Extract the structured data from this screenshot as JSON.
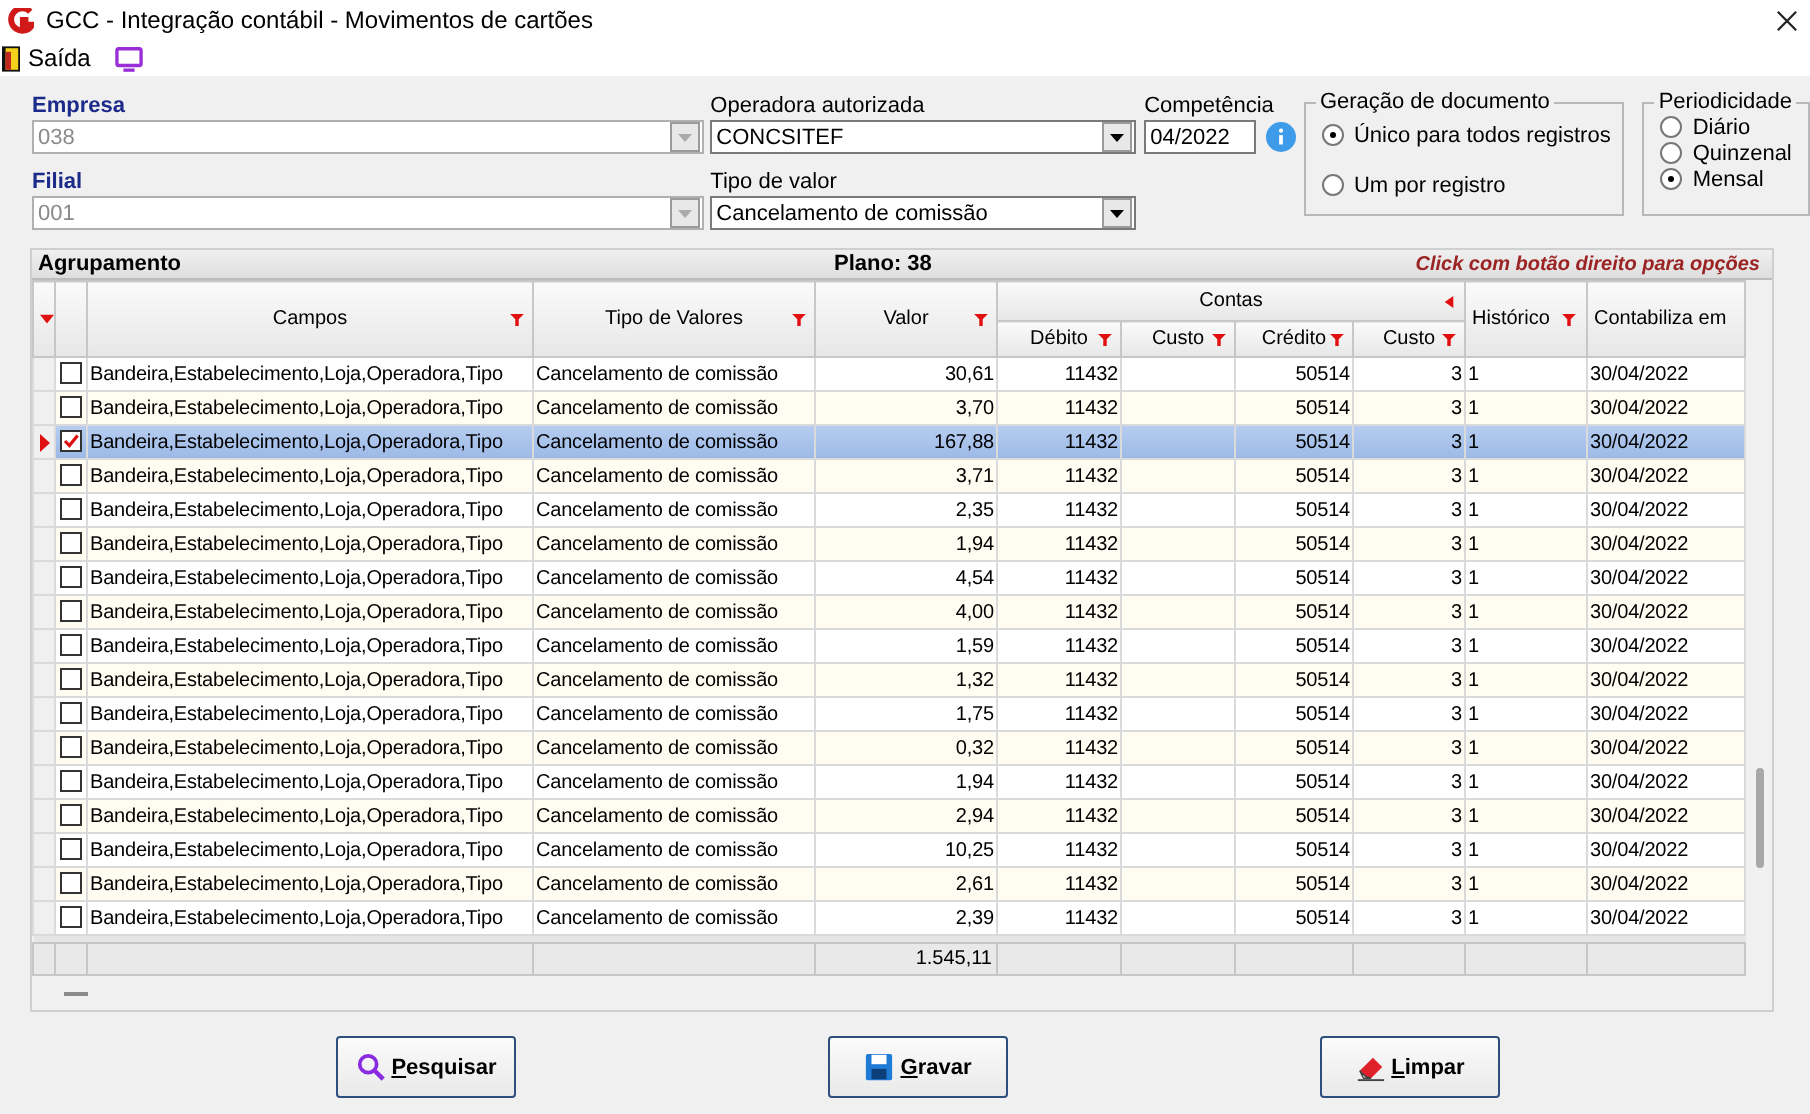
{
  "window": {
    "title": "GCC - Integração contábil - Movimentos de cartões"
  },
  "toolbar": {
    "exit_label": "Saída"
  },
  "form": {
    "empresa": {
      "label": "Empresa",
      "value": "038"
    },
    "filial": {
      "label": "Filial",
      "value": "001"
    },
    "operadora": {
      "label": "Operadora autorizada",
      "value": "CONCSITEF"
    },
    "tipo_valor": {
      "label": "Tipo de valor",
      "value": "Cancelamento de comissão"
    },
    "competencia": {
      "label": "Competência",
      "value": "04/2022"
    },
    "geracao": {
      "title": "Geração de documento",
      "options": [
        {
          "label": "Único para todos registros",
          "selected": true
        },
        {
          "label": "Um por registro",
          "selected": false
        }
      ]
    },
    "periodicidade": {
      "title": "Periodicidade",
      "options": [
        {
          "label": "Diário",
          "selected": false
        },
        {
          "label": "Quinzenal",
          "selected": false
        },
        {
          "label": "Mensal",
          "selected": true
        }
      ]
    }
  },
  "grid": {
    "title": "Agrupamento",
    "plan": "Plano: 38",
    "hint": "Click com botão direito para opções",
    "columns": {
      "campos": "Campos",
      "tipo": "Tipo de Valores",
      "valor": "Valor",
      "contas": "Contas",
      "debito": "Débito",
      "custo_1": "Custo",
      "credito": "Crédito",
      "custo_2": "Custo",
      "historico": "Histórico",
      "contabiliza": "Contabiliza em"
    },
    "rows": [
      {
        "checked": false,
        "selected": false,
        "campos": "Bandeira,Estabelecimento,Loja,Operadora,Tipo",
        "tipo": "Cancelamento de comissão",
        "valor": "30,61",
        "debito": "11432",
        "credito": "50514",
        "custo_2": "3",
        "historico": "1",
        "contabiliza": "30/04/2022"
      },
      {
        "checked": false,
        "selected": false,
        "campos": "Bandeira,Estabelecimento,Loja,Operadora,Tipo",
        "tipo": "Cancelamento de comissão",
        "valor": "3,70",
        "debito": "11432",
        "credito": "50514",
        "custo_2": "3",
        "historico": "1",
        "contabiliza": "30/04/2022"
      },
      {
        "checked": true,
        "selected": true,
        "campos": "Bandeira,Estabelecimento,Loja,Operadora,Tipo",
        "tipo": "Cancelamento de comissão",
        "valor": "167,88",
        "debito": "11432",
        "credito": "50514",
        "custo_2": "3",
        "historico": "1",
        "contabiliza": "30/04/2022"
      },
      {
        "checked": false,
        "selected": false,
        "campos": "Bandeira,Estabelecimento,Loja,Operadora,Tipo",
        "tipo": "Cancelamento de comissão",
        "valor": "3,71",
        "debito": "11432",
        "credito": "50514",
        "custo_2": "3",
        "historico": "1",
        "contabiliza": "30/04/2022"
      },
      {
        "checked": false,
        "selected": false,
        "campos": "Bandeira,Estabelecimento,Loja,Operadora,Tipo",
        "tipo": "Cancelamento de comissão",
        "valor": "2,35",
        "debito": "11432",
        "credito": "50514",
        "custo_2": "3",
        "historico": "1",
        "contabiliza": "30/04/2022"
      },
      {
        "checked": false,
        "selected": false,
        "campos": "Bandeira,Estabelecimento,Loja,Operadora,Tipo",
        "tipo": "Cancelamento de comissão",
        "valor": "1,94",
        "debito": "11432",
        "credito": "50514",
        "custo_2": "3",
        "historico": "1",
        "contabiliza": "30/04/2022"
      },
      {
        "checked": false,
        "selected": false,
        "campos": "Bandeira,Estabelecimento,Loja,Operadora,Tipo",
        "tipo": "Cancelamento de comissão",
        "valor": "4,54",
        "debito": "11432",
        "credito": "50514",
        "custo_2": "3",
        "historico": "1",
        "contabiliza": "30/04/2022"
      },
      {
        "checked": false,
        "selected": false,
        "campos": "Bandeira,Estabelecimento,Loja,Operadora,Tipo",
        "tipo": "Cancelamento de comissão",
        "valor": "4,00",
        "debito": "11432",
        "credito": "50514",
        "custo_2": "3",
        "historico": "1",
        "contabiliza": "30/04/2022"
      },
      {
        "checked": false,
        "selected": false,
        "campos": "Bandeira,Estabelecimento,Loja,Operadora,Tipo",
        "tipo": "Cancelamento de comissão",
        "valor": "1,59",
        "debito": "11432",
        "credito": "50514",
        "custo_2": "3",
        "historico": "1",
        "contabiliza": "30/04/2022"
      },
      {
        "checked": false,
        "selected": false,
        "campos": "Bandeira,Estabelecimento,Loja,Operadora,Tipo",
        "tipo": "Cancelamento de comissão",
        "valor": "1,32",
        "debito": "11432",
        "credito": "50514",
        "custo_2": "3",
        "historico": "1",
        "contabiliza": "30/04/2022"
      },
      {
        "checked": false,
        "selected": false,
        "campos": "Bandeira,Estabelecimento,Loja,Operadora,Tipo",
        "tipo": "Cancelamento de comissão",
        "valor": "1,75",
        "debito": "11432",
        "credito": "50514",
        "custo_2": "3",
        "historico": "1",
        "contabiliza": "30/04/2022"
      },
      {
        "checked": false,
        "selected": false,
        "campos": "Bandeira,Estabelecimento,Loja,Operadora,Tipo",
        "tipo": "Cancelamento de comissão",
        "valor": "0,32",
        "debito": "11432",
        "credito": "50514",
        "custo_2": "3",
        "historico": "1",
        "contabiliza": "30/04/2022"
      },
      {
        "checked": false,
        "selected": false,
        "campos": "Bandeira,Estabelecimento,Loja,Operadora,Tipo",
        "tipo": "Cancelamento de comissão",
        "valor": "1,94",
        "debito": "11432",
        "credito": "50514",
        "custo_2": "3",
        "historico": "1",
        "contabiliza": "30/04/2022"
      },
      {
        "checked": false,
        "selected": false,
        "campos": "Bandeira,Estabelecimento,Loja,Operadora,Tipo",
        "tipo": "Cancelamento de comissão",
        "valor": "2,94",
        "debito": "11432",
        "credito": "50514",
        "custo_2": "3",
        "historico": "1",
        "contabiliza": "30/04/2022"
      },
      {
        "checked": false,
        "selected": false,
        "campos": "Bandeira,Estabelecimento,Loja,Operadora,Tipo",
        "tipo": "Cancelamento de comissão",
        "valor": "10,25",
        "debito": "11432",
        "credito": "50514",
        "custo_2": "3",
        "historico": "1",
        "contabiliza": "30/04/2022"
      },
      {
        "checked": false,
        "selected": false,
        "campos": "Bandeira,Estabelecimento,Loja,Operadora,Tipo",
        "tipo": "Cancelamento de comissão",
        "valor": "2,61",
        "debito": "11432",
        "credito": "50514",
        "custo_2": "3",
        "historico": "1",
        "contabiliza": "30/04/2022"
      },
      {
        "checked": false,
        "selected": false,
        "campos": "Bandeira,Estabelecimento,Loja,Operadora,Tipo",
        "tipo": "Cancelamento de comissão",
        "valor": "2,39",
        "debito": "11432",
        "credito": "50514",
        "custo_2": "3",
        "historico": "1",
        "contabiliza": "30/04/2022"
      }
    ],
    "total": "1.545,11"
  },
  "buttons": [
    {
      "kind": "search",
      "label": "Pesquisar"
    },
    {
      "kind": "save",
      "label": "Gravar"
    },
    {
      "kind": "clear",
      "label": "Limpar"
    }
  ]
}
